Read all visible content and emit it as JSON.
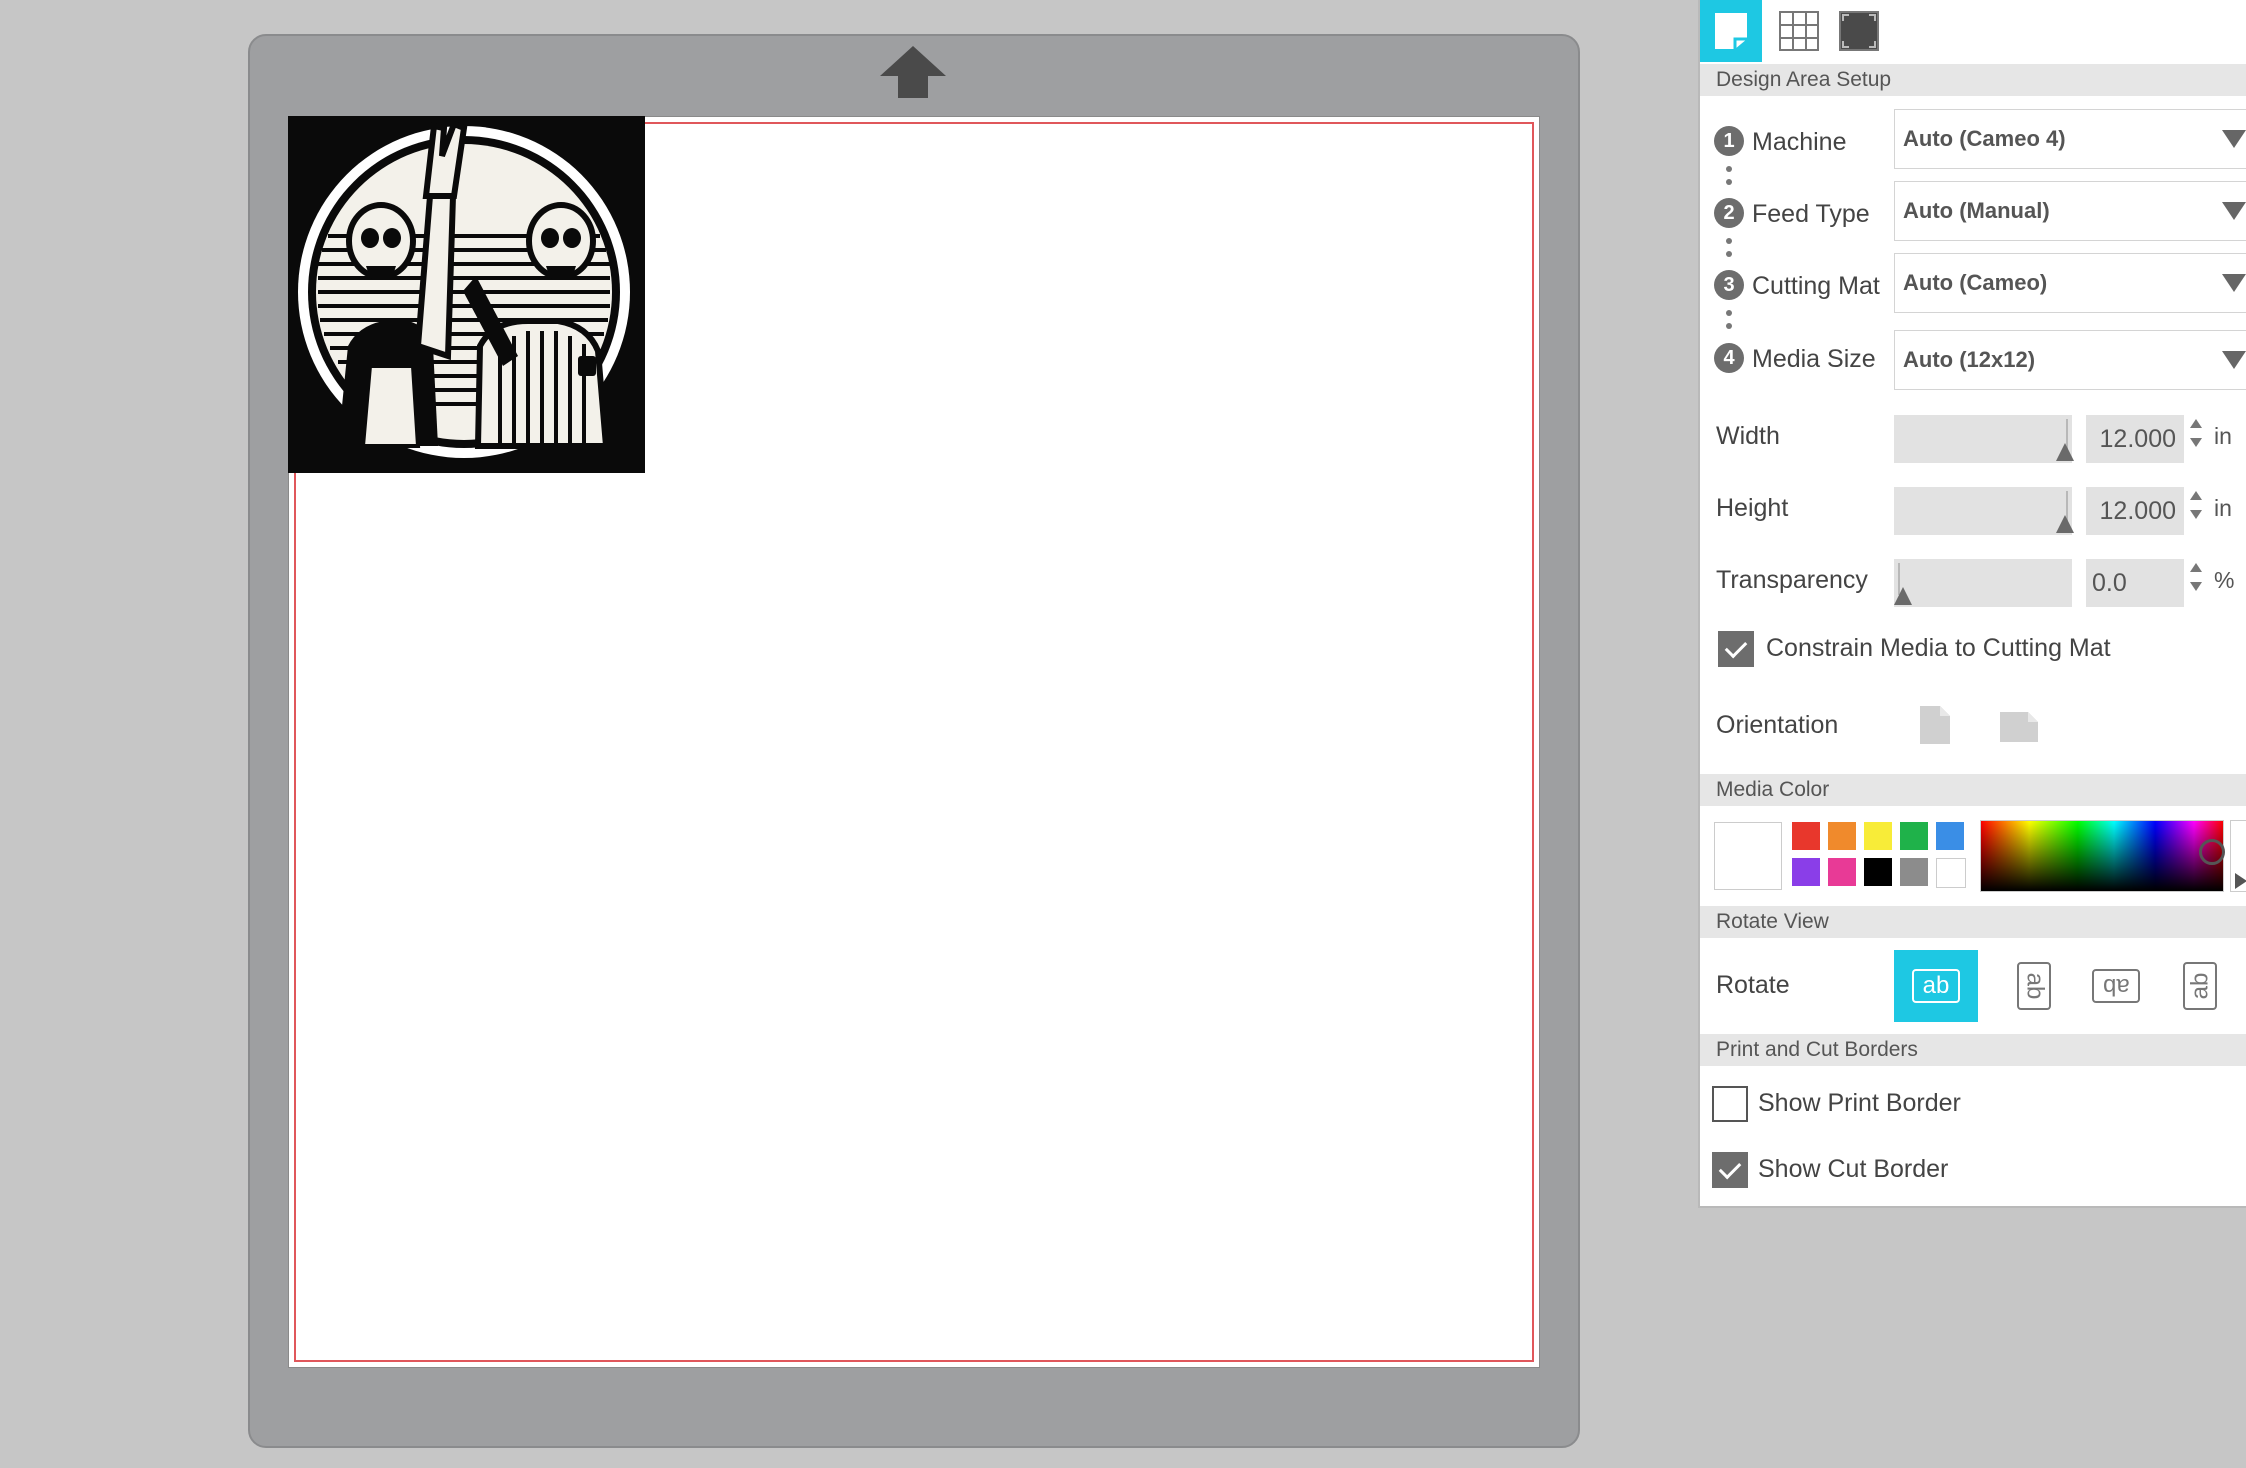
{
  "tabs": [
    {
      "icon": "page-setup-icon",
      "active": true
    },
    {
      "icon": "grid-icon",
      "active": false
    },
    {
      "icon": "cut-border-icon",
      "active": false
    }
  ],
  "design_area": {
    "header": "Design Area Setup",
    "machine": {
      "step": "1",
      "label": "Machine",
      "value": "Auto (Cameo 4)"
    },
    "feed_type": {
      "step": "2",
      "label": "Feed Type",
      "value": "Auto (Manual)"
    },
    "cutting_mat": {
      "step": "3",
      "label": "Cutting Mat",
      "value": "Auto (Cameo)"
    },
    "media_size": {
      "step": "4",
      "label": "Media Size",
      "value": "Auto (12x12)"
    },
    "width": {
      "label": "Width",
      "value": "12.000",
      "unit": "in"
    },
    "height": {
      "label": "Height",
      "value": "12.000",
      "unit": "in"
    },
    "transparency": {
      "label": "Transparency",
      "value": "0.0",
      "unit": "%"
    },
    "constrain": {
      "label": "Constrain Media to Cutting Mat",
      "checked": true
    },
    "orientation": {
      "label": "Orientation",
      "options": [
        "portrait-icon",
        "landscape-icon"
      ]
    }
  },
  "media_color": {
    "header": "Media Color",
    "current": "#ffffff",
    "swatches": [
      "#e8372c",
      "#f08a2c",
      "#f8ec38",
      "#1fb24a",
      "#3a8ee6",
      "#8a3ee8",
      "#e83a96",
      "#000000",
      "#8c8c8c",
      "#ffffff"
    ]
  },
  "rotate_view": {
    "header": "Rotate View",
    "label": "Rotate",
    "options": [
      {
        "text": "ab",
        "rotation": 0,
        "active": true
      },
      {
        "text": "ab",
        "rotation": 90,
        "active": false
      },
      {
        "text": "ab",
        "rotation": 180,
        "active": false
      },
      {
        "text": "ab",
        "rotation": 270,
        "active": false
      }
    ]
  },
  "borders": {
    "header": "Print and Cut Borders",
    "show_print": {
      "label": "Show Print Border",
      "checked": false
    },
    "show_cut": {
      "label": "Show Cut Border",
      "checked": true
    }
  },
  "colors": {
    "accent": "#1ec8e3",
    "cut_border": "#e0575b",
    "mat": "#9e9fa1"
  }
}
